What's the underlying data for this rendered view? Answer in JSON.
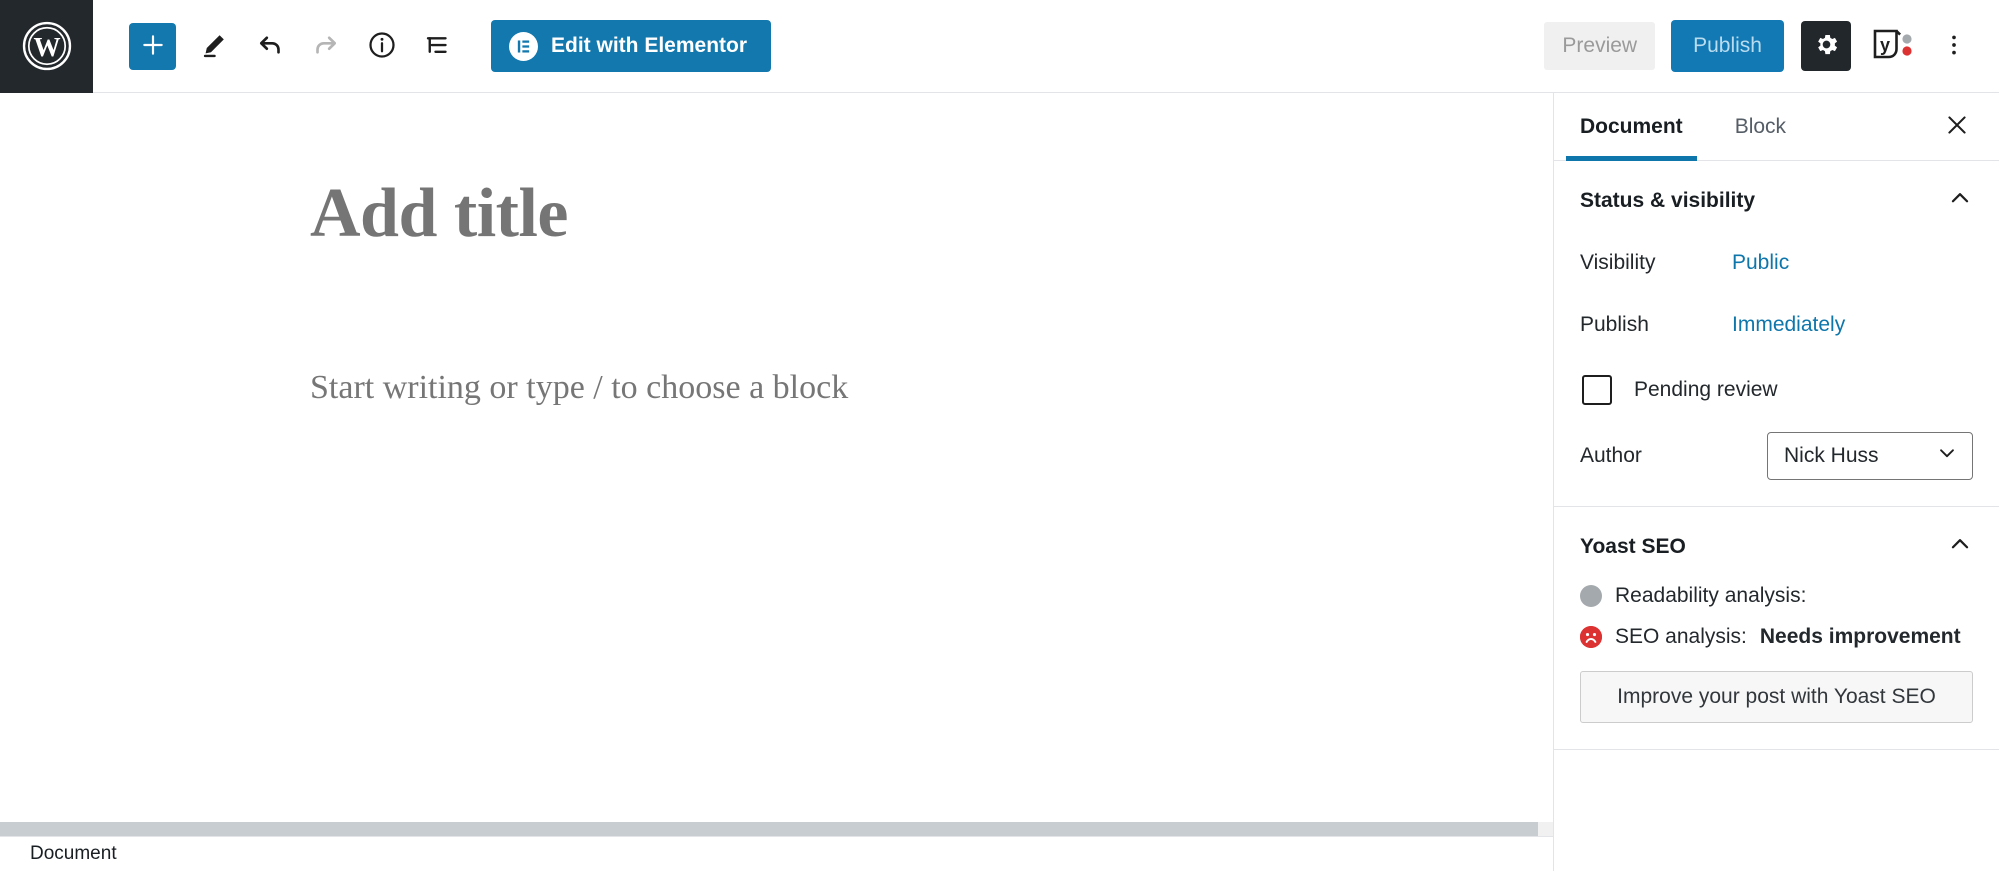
{
  "toolbar": {
    "wp_logo_icon": "wordpress-logo-icon",
    "add_block_label": "+",
    "add_block_icon": "plus-icon",
    "edit_icon": "pencil-edit-icon",
    "undo_icon": "undo-arrow-icon",
    "redo_icon": "redo-arrow-icon",
    "info_icon": "info-circle-icon",
    "list_view_icon": "list-view-icon",
    "elementor_label": "Edit with Elementor",
    "elementor_icon": "elementor-logo-icon",
    "preview_label": "Preview",
    "publish_label": "Publish",
    "settings_icon": "gear-icon",
    "yoast_icon": "yoast-seo-logo-icon",
    "more_icon": "kebab-vertical-icon",
    "accent_blue": "#1278ae",
    "publish_blue": "#1279b5",
    "dark": "#23282d"
  },
  "editor": {
    "title_placeholder": "Add title",
    "body_placeholder": "Start writing or type / to choose a block"
  },
  "sidebar": {
    "tabs": [
      {
        "label": "Document",
        "active": true
      },
      {
        "label": "Block",
        "active": false
      }
    ],
    "close_icon": "close-icon",
    "collapse_icon": "chevron-up-icon",
    "status_panel": {
      "title": "Status & visibility",
      "visibility_label": "Visibility",
      "visibility_value": "Public",
      "publish_label": "Publish",
      "publish_value": "Immediately",
      "pending_review_label": "Pending review",
      "pending_review_checked": false,
      "author_label": "Author",
      "author_value": "Nick Huss",
      "author_chevron_icon": "chevron-down-icon"
    },
    "yoast_panel": {
      "title": "Yoast SEO",
      "readability_label": "Readability analysis:",
      "readability_value": "",
      "readability_status_color": "#a4a9ad",
      "readability_icon": "gray-circle-status-icon",
      "seo_label": "SEO analysis:",
      "seo_value": "Needs improvement",
      "seo_status_color": "#dc3232",
      "seo_icon": "red-sad-face-status-icon",
      "improve_button_label": "Improve your post with Yoast SEO"
    }
  },
  "statusbar": {
    "label": "Document"
  }
}
